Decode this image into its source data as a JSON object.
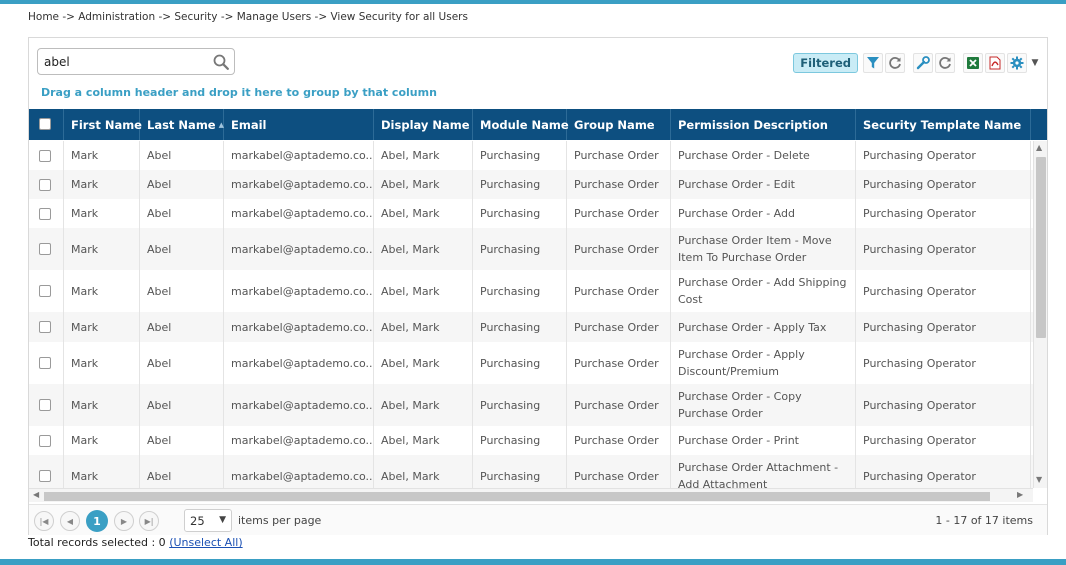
{
  "breadcrumb": "Home -> Administration -> Security -> Manage Users -> View Security for all Users",
  "search": {
    "value": "abel",
    "placeholder": ""
  },
  "group_hint": "Drag a column header and drop it here to group by that column",
  "toolbar": {
    "filtered_label": "Filtered",
    "icons": [
      "filter-icon",
      "refresh-icon",
      "wrench-icon",
      "refresh-icon",
      "excel-icon",
      "pdf-icon",
      "gear-icon",
      "caret-down-icon"
    ]
  },
  "columns": [
    "First Name",
    "Last Name",
    "Email",
    "Display Name",
    "Module Name",
    "Group Name",
    "Permission Description",
    "Security Template Name"
  ],
  "rows": [
    {
      "first": "Mark",
      "last": "Abel",
      "email": "markabel@aptademo.co...",
      "display": "Abel, Mark",
      "module": "Purchasing",
      "group": "Purchase Order",
      "permission": "Purchase Order - Delete",
      "template": "Purchasing Operator"
    },
    {
      "first": "Mark",
      "last": "Abel",
      "email": "markabel@aptademo.co...",
      "display": "Abel, Mark",
      "module": "Purchasing",
      "group": "Purchase Order",
      "permission": "Purchase Order - Edit",
      "template": "Purchasing Operator"
    },
    {
      "first": "Mark",
      "last": "Abel",
      "email": "markabel@aptademo.co...",
      "display": "Abel, Mark",
      "module": "Purchasing",
      "group": "Purchase Order",
      "permission": "Purchase Order - Add",
      "template": "Purchasing Operator"
    },
    {
      "first": "Mark",
      "last": "Abel",
      "email": "markabel@aptademo.co...",
      "display": "Abel, Mark",
      "module": "Purchasing",
      "group": "Purchase Order",
      "permission": "Purchase Order Item - Move Item To Purchase Order",
      "template": "Purchasing Operator"
    },
    {
      "first": "Mark",
      "last": "Abel",
      "email": "markabel@aptademo.co...",
      "display": "Abel, Mark",
      "module": "Purchasing",
      "group": "Purchase Order",
      "permission": "Purchase Order - Add Shipping Cost",
      "template": "Purchasing Operator"
    },
    {
      "first": "Mark",
      "last": "Abel",
      "email": "markabel@aptademo.co...",
      "display": "Abel, Mark",
      "module": "Purchasing",
      "group": "Purchase Order",
      "permission": "Purchase Order - Apply Tax",
      "template": "Purchasing Operator"
    },
    {
      "first": "Mark",
      "last": "Abel",
      "email": "markabel@aptademo.co...",
      "display": "Abel, Mark",
      "module": "Purchasing",
      "group": "Purchase Order",
      "permission": "Purchase Order - Apply Discount/Premium",
      "template": "Purchasing Operator"
    },
    {
      "first": "Mark",
      "last": "Abel",
      "email": "markabel@aptademo.co...",
      "display": "Abel, Mark",
      "module": "Purchasing",
      "group": "Purchase Order",
      "permission": "Purchase Order - Copy Purchase Order",
      "template": "Purchasing Operator"
    },
    {
      "first": "Mark",
      "last": "Abel",
      "email": "markabel@aptademo.co...",
      "display": "Abel, Mark",
      "module": "Purchasing",
      "group": "Purchase Order",
      "permission": "Purchase Order - Print",
      "template": "Purchasing Operator"
    },
    {
      "first": "Mark",
      "last": "Abel",
      "email": "markabel@aptademo.co...",
      "display": "Abel, Mark",
      "module": "Purchasing",
      "group": "Purchase Order",
      "permission": "Purchase Order Attachment - Add Attachment",
      "template": "Purchasing Operator"
    }
  ],
  "pager": {
    "current_page": "1",
    "items_per_page": "25",
    "items_per_page_label": "items per page",
    "info": "1 - 17 of 17 items"
  },
  "footer": {
    "selected_text": "Total records selected : 0",
    "unselect_label": "(Unselect All)"
  },
  "colors": {
    "accent": "#3a9fc4",
    "header_bg": "#0d4f80"
  }
}
